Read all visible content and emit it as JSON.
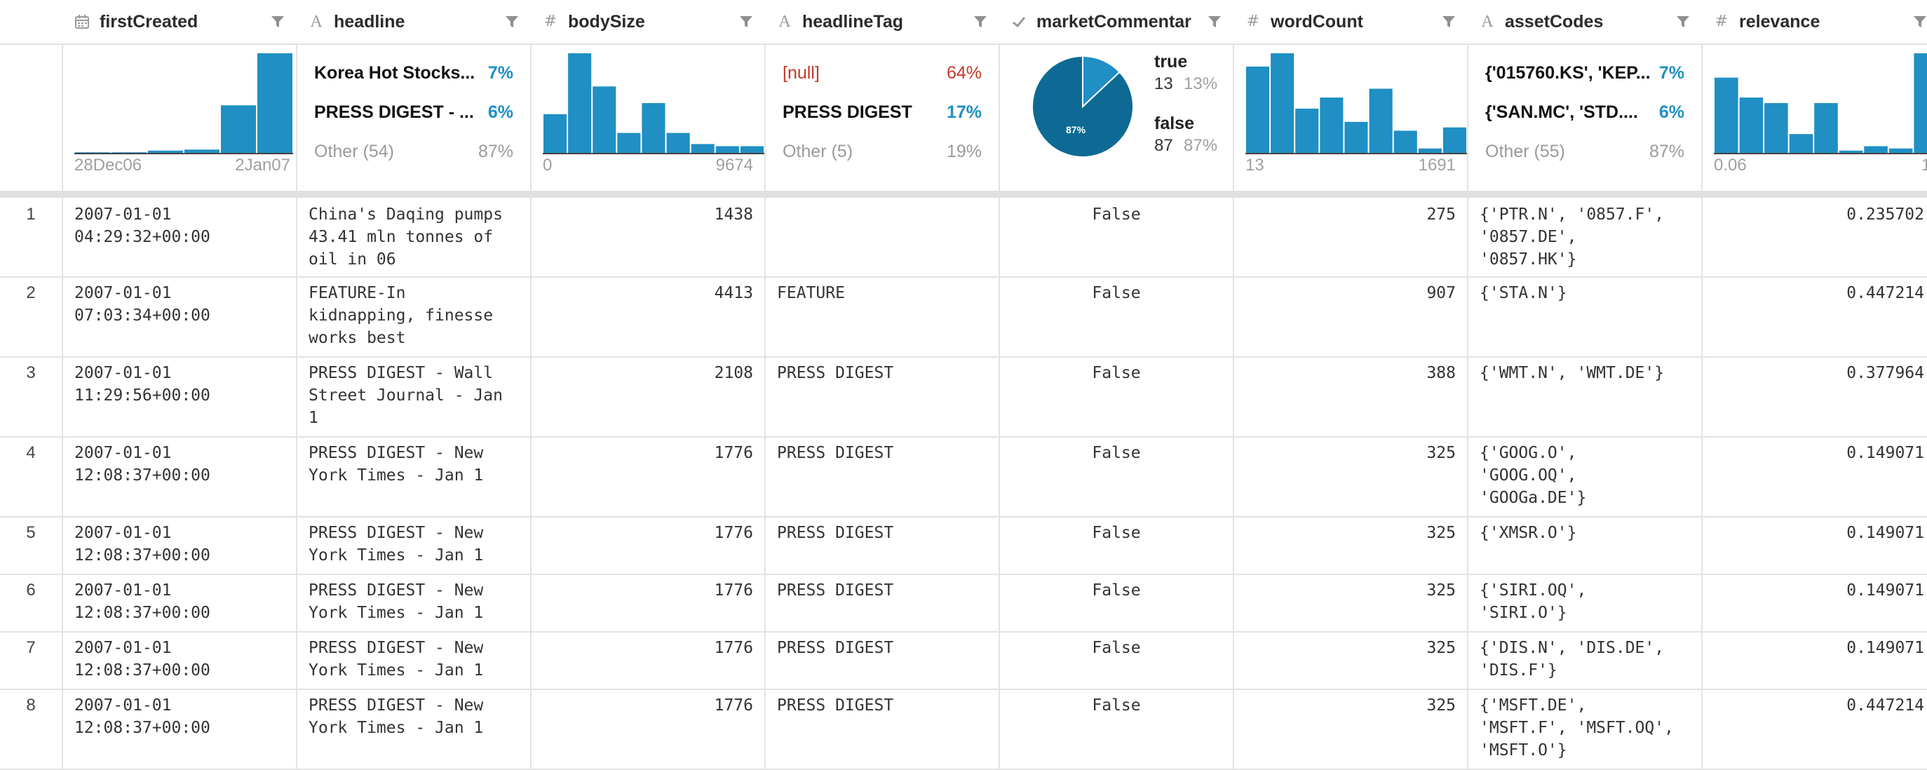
{
  "columns": [
    {
      "key": "firstCreated",
      "type_icon": "calendar-icon",
      "name": "firstCreated"
    },
    {
      "key": "headline",
      "type_icon": "text-type-icon",
      "name": "headline"
    },
    {
      "key": "bodySize",
      "type_icon": "number-type-icon",
      "name": "bodySize"
    },
    {
      "key": "headlineTag",
      "type_icon": "text-type-icon",
      "name": "headlineTag"
    },
    {
      "key": "marketCommentary",
      "type_icon": "boolean-check-icon",
      "name": "marketCommentar"
    },
    {
      "key": "wordCount",
      "type_icon": "number-type-icon",
      "name": "wordCount"
    },
    {
      "key": "assetCodes",
      "type_icon": "text-type-icon",
      "name": "assetCodes"
    },
    {
      "key": "relevance",
      "type_icon": "number-type-icon",
      "name": "relevance"
    }
  ],
  "summary": {
    "firstCreated": {
      "axis_min": "28Dec06",
      "axis_max": "2Jan07"
    },
    "headline": {
      "top": [
        {
          "label": "Korea Hot Stocks...",
          "pct": "7%"
        },
        {
          "label": "PRESS DIGEST - ...",
          "pct": "6%"
        }
      ],
      "other": {
        "label": "Other (54)",
        "pct": "87%"
      }
    },
    "bodySize": {
      "axis_min": "0",
      "axis_max": "9674"
    },
    "headlineTag": {
      "top": [
        {
          "label": "[null]",
          "pct": "64%"
        },
        {
          "label": "PRESS DIGEST",
          "pct": "17%"
        }
      ],
      "other": {
        "label": "Other (5)",
        "pct": "19%"
      }
    },
    "marketCommentary": {
      "pie_label": "87%",
      "true_label": "true",
      "true_count": "13",
      "true_pct": "13%",
      "false_label": "false",
      "false_count": "87",
      "false_pct": "87%"
    },
    "wordCount": {
      "axis_min": "13",
      "axis_max": "1691"
    },
    "assetCodes": {
      "top": [
        {
          "label": "{'015760.KS', 'KEP....",
          "pct": "7%"
        },
        {
          "label": "{'SAN.MC', 'STD....",
          "pct": "6%"
        }
      ],
      "other": {
        "label": "Other (55)",
        "pct": "87%"
      }
    },
    "relevance": {
      "axis_min": "0.06",
      "axis_max": "1"
    }
  },
  "chart_data": [
    {
      "type": "bar",
      "title": "",
      "column": "firstCreated",
      "values": [
        0.5,
        0.5,
        2,
        3,
        43,
        90
      ],
      "xlim": [
        "28Dec06",
        "2Jan07"
      ]
    },
    {
      "type": "bar",
      "title": "",
      "column": "bodySize",
      "values": [
        35,
        90,
        60,
        18,
        45,
        18,
        8,
        6,
        6
      ],
      "xlim": [
        0,
        9674
      ]
    },
    {
      "type": "pie",
      "title": "",
      "column": "marketCommentary",
      "slices": [
        {
          "name": "true",
          "value": 13
        },
        {
          "name": "false",
          "value": 87
        }
      ]
    },
    {
      "type": "bar",
      "title": "",
      "column": "wordCount",
      "values": [
        78,
        90,
        40,
        50,
        28,
        58,
        20,
        4,
        23
      ],
      "xlim": [
        13,
        1691
      ]
    },
    {
      "type": "bar",
      "title": "",
      "column": "relevance",
      "values": [
        68,
        50,
        45,
        17,
        45,
        2,
        6,
        4,
        90
      ],
      "xlim": [
        0.06,
        1
      ]
    }
  ],
  "rows": [
    {
      "idx": "1",
      "firstCreated": "2007-01-01\n04:29:32+00:00",
      "headline": "China's Daqing pumps\n43.41 mln tonnes of\noil in 06",
      "bodySize": "1438",
      "headlineTag": "",
      "marketCommentary": "False",
      "wordCount": "275",
      "assetCodes": "{'PTR.N', '0857.F',\n'0857.DE',\n'0857.HK'}",
      "relevance": "0.235702"
    },
    {
      "idx": "2",
      "firstCreated": "2007-01-01\n07:03:34+00:00",
      "headline": "FEATURE-In\nkidnapping, finesse\nworks best",
      "bodySize": "4413",
      "headlineTag": "FEATURE",
      "marketCommentary": "False",
      "wordCount": "907",
      "assetCodes": "{'STA.N'}",
      "relevance": "0.447214"
    },
    {
      "idx": "3",
      "firstCreated": "2007-01-01\n11:29:56+00:00",
      "headline": "PRESS DIGEST - Wall\nStreet Journal - Jan\n1",
      "bodySize": "2108",
      "headlineTag": "PRESS DIGEST",
      "marketCommentary": "False",
      "wordCount": "388",
      "assetCodes": "{'WMT.N', 'WMT.DE'}",
      "relevance": "0.377964"
    },
    {
      "idx": "4",
      "firstCreated": "2007-01-01\n12:08:37+00:00",
      "headline": "PRESS DIGEST - New\nYork Times - Jan 1",
      "bodySize": "1776",
      "headlineTag": "PRESS DIGEST",
      "marketCommentary": "False",
      "wordCount": "325",
      "assetCodes": "{'GOOG.O',\n'GOOG.OQ',\n'GOOGa.DE'}",
      "relevance": "0.149071"
    },
    {
      "idx": "5",
      "firstCreated": "2007-01-01\n12:08:37+00:00",
      "headline": "PRESS DIGEST - New\nYork Times - Jan 1",
      "bodySize": "1776",
      "headlineTag": "PRESS DIGEST",
      "marketCommentary": "False",
      "wordCount": "325",
      "assetCodes": "{'XMSR.O'}",
      "relevance": "0.149071"
    },
    {
      "idx": "6",
      "firstCreated": "2007-01-01\n12:08:37+00:00",
      "headline": "PRESS DIGEST - New\nYork Times - Jan 1",
      "bodySize": "1776",
      "headlineTag": "PRESS DIGEST",
      "marketCommentary": "False",
      "wordCount": "325",
      "assetCodes": "{'SIRI.OQ',\n'SIRI.O'}",
      "relevance": "0.149071"
    },
    {
      "idx": "7",
      "firstCreated": "2007-01-01\n12:08:37+00:00",
      "headline": "PRESS DIGEST - New\nYork Times - Jan 1",
      "bodySize": "1776",
      "headlineTag": "PRESS DIGEST",
      "marketCommentary": "False",
      "wordCount": "325",
      "assetCodes": "{'DIS.N', 'DIS.DE',\n'DIS.F'}",
      "relevance": "0.149071"
    },
    {
      "idx": "8",
      "firstCreated": "2007-01-01\n12:08:37+00:00",
      "headline": "PRESS DIGEST - New\nYork Times - Jan 1",
      "bodySize": "1776",
      "headlineTag": "PRESS DIGEST",
      "marketCommentary": "False",
      "wordCount": "325",
      "assetCodes": "{'MSFT.DE',\n'MSFT.F', 'MSFT.OQ',\n'MSFT.O'}",
      "relevance": "0.447214"
    }
  ],
  "colors": {
    "bar": "#1f8fc4",
    "pie_false": "#0e6a94",
    "pie_true": "#1f8fc4",
    "null": "#c0392b",
    "accent": "#1f8fc4"
  }
}
